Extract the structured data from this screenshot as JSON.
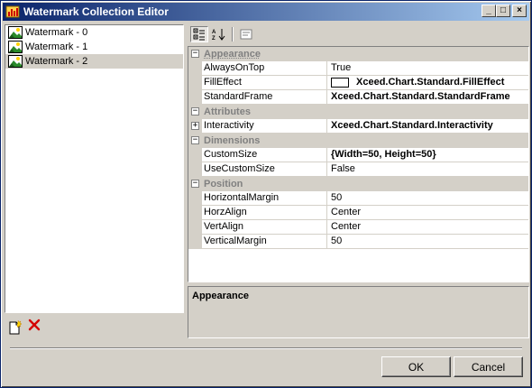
{
  "window": {
    "title": "Watermark Collection Editor",
    "minimize_label": "_",
    "maximize_label": "□",
    "close_label": "×"
  },
  "members": {
    "items": [
      {
        "label": "Watermark - 0",
        "selected": false
      },
      {
        "label": "Watermark - 1",
        "selected": false
      },
      {
        "label": "Watermark - 2",
        "selected": true
      }
    ]
  },
  "property_grid": {
    "categories": [
      {
        "name": "Appearance",
        "expanded": true,
        "properties": [
          {
            "name": "AlwaysOnTop",
            "value": "True",
            "bold": false
          },
          {
            "name": "FillEffect",
            "value": "Xceed.Chart.Standard.FillEffect",
            "bold": true,
            "swatch": "#ffffff"
          },
          {
            "name": "StandardFrame",
            "value": "Xceed.Chart.Standard.StandardFrame",
            "bold": true
          }
        ]
      },
      {
        "name": "Attributes",
        "expanded": true,
        "properties": [
          {
            "name": "Interactivity",
            "value": "Xceed.Chart.Standard.Interactivity",
            "bold": true,
            "expandable": true
          }
        ]
      },
      {
        "name": "Dimensions",
        "expanded": true,
        "properties": [
          {
            "name": "CustomSize",
            "value": "{Width=50, Height=50}",
            "bold": true
          },
          {
            "name": "UseCustomSize",
            "value": "False",
            "bold": false
          }
        ]
      },
      {
        "name": "Position",
        "expanded": true,
        "properties": [
          {
            "name": "HorizontalMargin",
            "value": "50",
            "bold": false
          },
          {
            "name": "HorzAlign",
            "value": "Center",
            "bold": false
          },
          {
            "name": "VertAlign",
            "value": "Center",
            "bold": false
          },
          {
            "name": "VerticalMargin",
            "value": "50",
            "bold": false
          }
        ]
      }
    ],
    "description_title": "Appearance"
  },
  "buttons": {
    "ok": "OK",
    "cancel": "Cancel"
  },
  "colors": {
    "title_start": "#0a246a",
    "title_end": "#a6caf0",
    "face": "#d4d0c8",
    "delete_red": "#d40000"
  }
}
